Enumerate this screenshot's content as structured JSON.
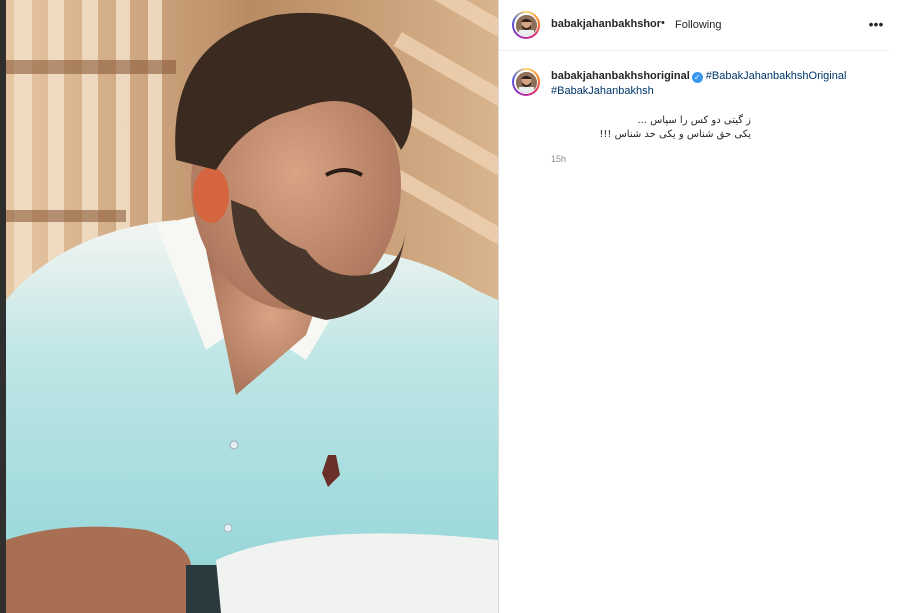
{
  "post": {
    "username": "babakjahanbakhshoriginal",
    "header_username": "babakjahanbakhshorig",
    "separator": "•",
    "follow_status": "Following",
    "more_icon": "more-horizontal-icon",
    "verified_icon": "verified-badge-icon",
    "hashtag_1": "#BabakJahanbakhshOriginal",
    "hashtag_2": "#BabakJahanbakhsh",
    "caption_line_1": "ز گیتی دو کس را سپاس ...",
    "caption_line_2": "یکی حق شناس و یکی حد شناس !!!",
    "time_ago": "15h"
  },
  "colors": {
    "hashtag": "#00376b",
    "verified": "#3897f0",
    "meta": "#8e8e8e",
    "text": "#262626"
  }
}
